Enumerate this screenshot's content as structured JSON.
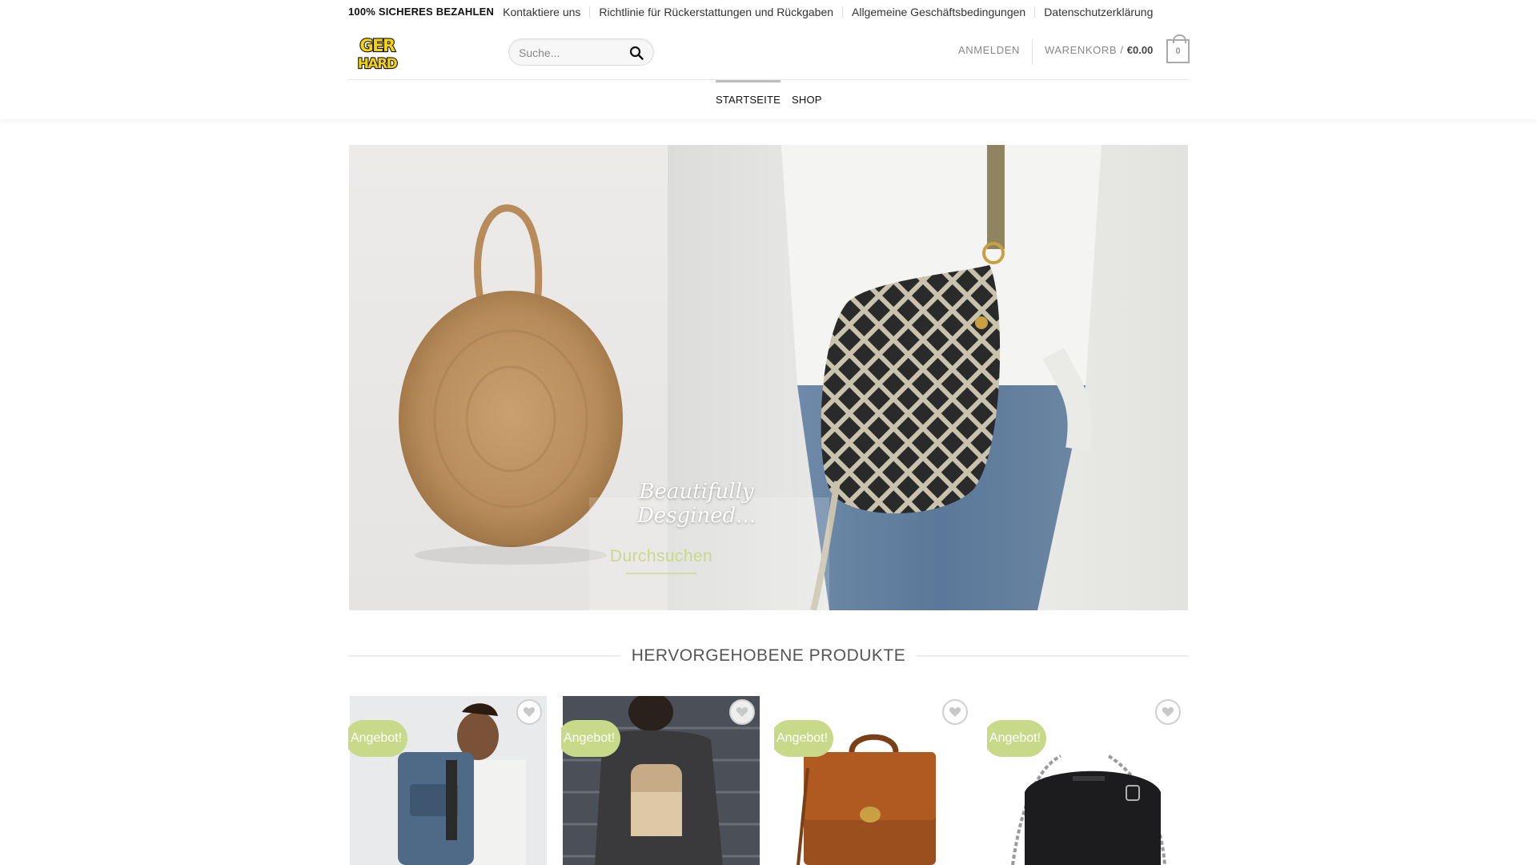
{
  "topbar": {
    "secure_payment": "100% SICHERES BEZAHLEN",
    "links": [
      "Kontaktiere uns",
      "Richtlinie für Rückerstattungen und Rückgaben",
      "Allgemeine Geschäftsbedingungen",
      "Datenschutzerklärung"
    ]
  },
  "header": {
    "logo_text_top": "GER",
    "logo_text_bottom": "HARD",
    "search_placeholder": "Suche...",
    "account_label": "ANMELDEN",
    "cart_label": "WARENKORB /",
    "cart_amount": "€0.00",
    "cart_count": "0"
  },
  "nav": {
    "items": [
      "STARTSEITE",
      "SHOP"
    ],
    "active_index": 0
  },
  "hero": {
    "tagline": "Beautifully Desgined...",
    "cta": "Durchsuchen"
  },
  "featured": {
    "title": "HERVORGEHOBENE PRODUKTE",
    "products": [
      {
        "badge": "Angebot!",
        "image": "man-with-blue-backpack"
      },
      {
        "badge": "Angebot!",
        "image": "woman-with-gold-backpack"
      },
      {
        "badge": "Angebot!",
        "image": "brown-leather-satchel"
      },
      {
        "badge": "Angebot!",
        "image": "black-crossbody-bag"
      }
    ]
  },
  "colors": {
    "accent": "#c9d98a",
    "logo_yellow": "#f5d20a",
    "text_dark": "#111111",
    "text_muted": "#888888"
  },
  "icons": {
    "search": "search-icon",
    "wishlist": "heart-icon",
    "cart": "cart-bag-icon"
  }
}
